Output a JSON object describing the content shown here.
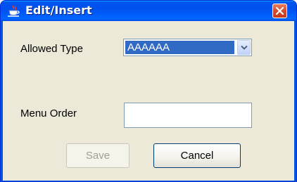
{
  "window": {
    "title": "Edit/Insert",
    "icon": "java-coffee-cup-icon",
    "close_icon": "close-x-icon"
  },
  "form": {
    "allowed_type_label": "Allowed Type",
    "allowed_type_value": "AAAAAA",
    "menu_order_label": "Menu Order",
    "menu_order_value": ""
  },
  "buttons": {
    "save": "Save",
    "cancel": "Cancel"
  },
  "colors": {
    "title_bar": "#0054e3",
    "selection": "#316ac5",
    "client_bg": "#ece9d8",
    "close_button": "#d94b2a"
  }
}
